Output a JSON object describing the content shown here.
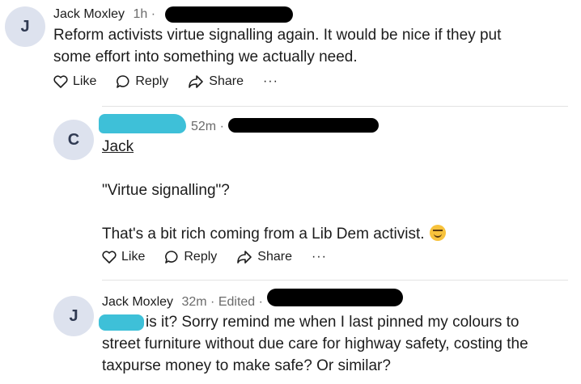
{
  "comments": [
    {
      "avatar_letter": "J",
      "author": "Jack Moxley",
      "time": "1h ·",
      "body_lines": [
        "Reform activists virtue signalling again. It would be nice if they put",
        "some effort into something we actually need."
      ],
      "actions": {
        "like": "Like",
        "reply": "Reply",
        "share": "Share",
        "more": "···"
      }
    },
    {
      "avatar_letter": "C",
      "time": "52m ·",
      "mention": "Jack",
      "body_line_1": "\"Virtue signalling\"?",
      "body_line_2": "That's a bit rich coming from a Lib Dem activist.",
      "actions": {
        "like": "Like",
        "reply": "Reply",
        "share": "Share",
        "more": "···"
      }
    },
    {
      "avatar_letter": "J",
      "author": "Jack Moxley",
      "time": "32m · Edited ·",
      "body_line_1": "is it? Sorry remind me when I last pinned my colours to",
      "body_line_2": "street furniture without due care for highway safety, costing the",
      "body_line_3": "taxpurse money to make safe? Or similar?"
    }
  ],
  "colors": {
    "avatar_bg": "#dde2ee",
    "redaction_black": "#000000",
    "redaction_cyan": "#3ec0d8",
    "text": "#1c1c1c",
    "muted": "#6b6b6b"
  }
}
